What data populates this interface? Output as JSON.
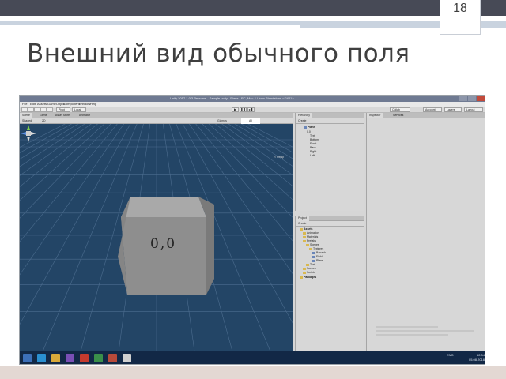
{
  "slide": {
    "number": "18",
    "title": "Внешний вид обычного поля"
  },
  "editor": {
    "window_title": "Unity 2017.1.0f3 Personal - Sample.unity - Plane - PC, Mac & Linux Standalone <DX11>",
    "menu": [
      "File",
      "Edit",
      "Assets",
      "GameObject",
      "Component",
      "Window",
      "Help"
    ],
    "toolbar": {
      "pivot_label": "Pivot",
      "local_label": "Local",
      "collab_label": "Collab",
      "account_label": "Account",
      "layers_label": "Layers",
      "layout_label": "Layout"
    },
    "scene": {
      "tabs": [
        "Scene",
        "Game",
        "Asset Store",
        "Animator"
      ],
      "shading_label": "Shaded",
      "mode_label": "2D",
      "gizmos_label": "Gizmos",
      "search_placeholder": "All",
      "breadcrumb_root": "Scenes",
      "breadcrumb_item": "Plane",
      "cube_label": "0,0",
      "persp_label": "< Persp"
    },
    "hierarchy": {
      "tab": "Hierarchy",
      "create_label": "Create",
      "root": "Plane",
      "items": [
        "0,0",
        "Text",
        "Bottom",
        "Front",
        "Back",
        "Right",
        "Left"
      ]
    },
    "project": {
      "tab": "Project",
      "create_label": "Create",
      "root": "Assets",
      "folders": [
        "Animation",
        "Materials",
        "Prefabs",
        "Scenes",
        "Textures",
        "Barrack",
        "Field",
        "Plane",
        "Text",
        "Scenes",
        "Scripts"
      ],
      "packages_label": "Packages"
    },
    "inspector": {
      "tabs": [
        "Inspector",
        "Services"
      ]
    }
  },
  "taskbar": {
    "tray_lang": "ENG",
    "tray_time": "22:04",
    "tray_date": "05.08.2018"
  },
  "colors": {
    "viewport_bg": "#234566",
    "grid_line": "#4c6d8f",
    "cube_front": "#8e8e8e",
    "cube_top": "#a9a9a9",
    "cube_side": "#7a7a7a",
    "taskbar_bg": "#122846"
  }
}
